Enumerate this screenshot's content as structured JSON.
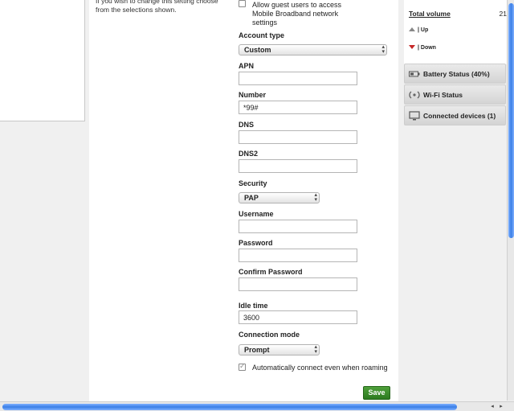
{
  "hint_text": "If you wish to change this setting choose from the selections shown.",
  "guest_access": {
    "label": "Allow guest users to access Mobile Broadband network settings",
    "checked": false
  },
  "form": {
    "account_type": {
      "label": "Account type",
      "value": "Custom"
    },
    "apn": {
      "label": "APN",
      "value": ""
    },
    "number": {
      "label": "Number",
      "value": "*99#"
    },
    "dns": {
      "label": "DNS",
      "value": ""
    },
    "dns2": {
      "label": "DNS2",
      "value": ""
    },
    "security": {
      "label": "Security",
      "value": "PAP"
    },
    "username": {
      "label": "Username",
      "value": ""
    },
    "password": {
      "label": "Password",
      "value": ""
    },
    "confirm_password": {
      "label": "Confirm Password",
      "value": ""
    },
    "idle_time": {
      "label": "Idle time",
      "value": "3600"
    },
    "connection_mode": {
      "label": "Connection mode",
      "value": "Prompt"
    },
    "auto_connect": {
      "label": "Automatically connect even when roaming",
      "checked": true
    }
  },
  "save_label": "Save",
  "sidebar": {
    "volume_title": "Total volume",
    "volume_value": "21",
    "legend_up": "| Up",
    "legend_down": "| Down",
    "battery_label": "Battery Status (40%)",
    "wifi_label": "Wi-Fi Status",
    "devices_label": "Connected devices (1)"
  },
  "scroll": {
    "left_arrow": "◂",
    "right_arrow": "▸"
  }
}
